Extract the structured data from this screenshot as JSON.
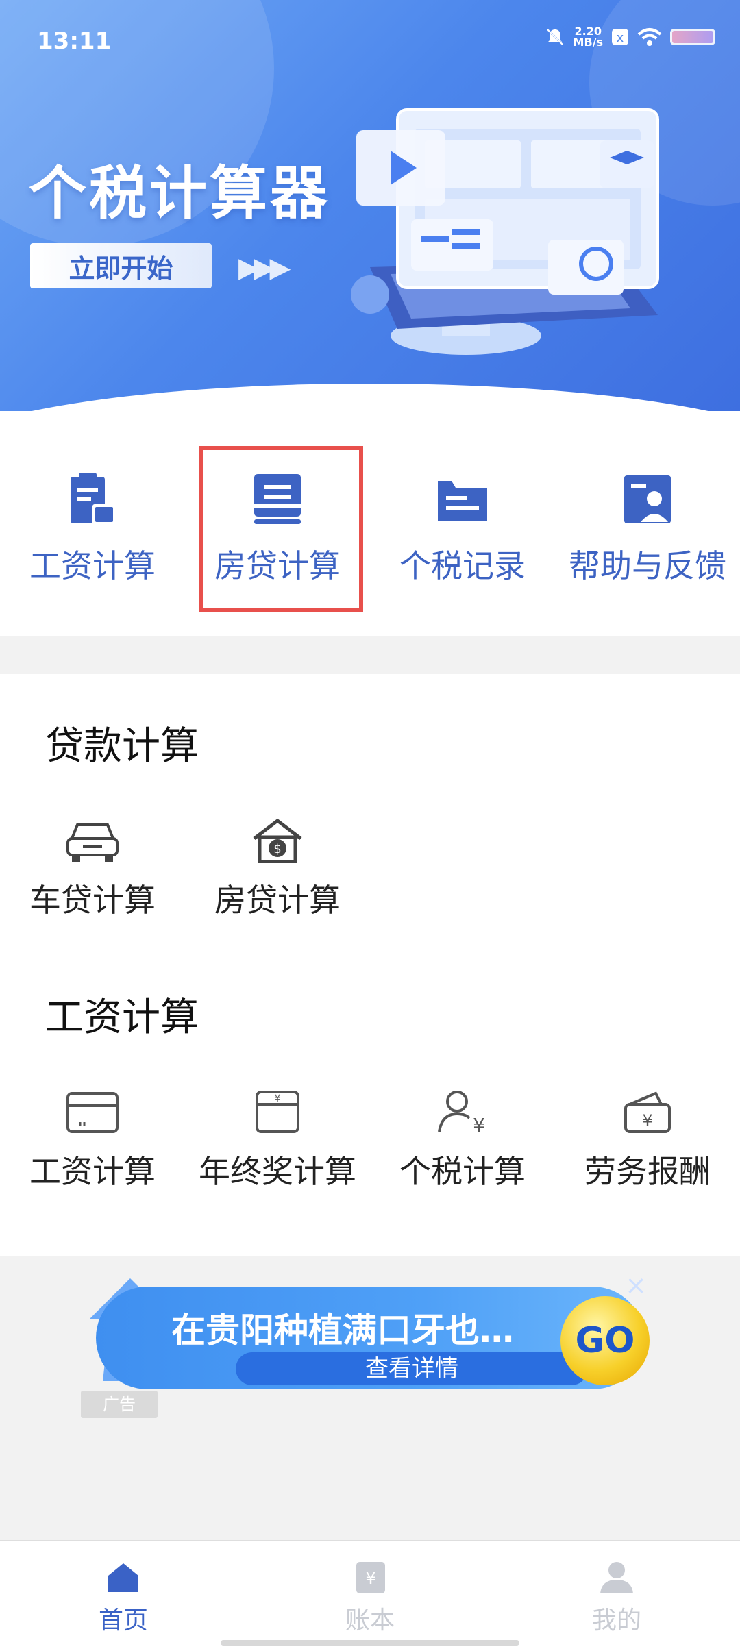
{
  "status_bar": {
    "time": "13:11",
    "net_speed_value": "2.20",
    "net_speed_unit": "MB/s"
  },
  "hero": {
    "title": "个税计算器",
    "start_button": "立即开始",
    "arrows": "▶▶▶"
  },
  "quick_grid": [
    {
      "label": "工资计算",
      "icon": "clipboard-icon"
    },
    {
      "label": "房贷计算",
      "icon": "document-lines-icon"
    },
    {
      "label": "个税记录",
      "icon": "folder-icon"
    },
    {
      "label": "帮助与反馈",
      "icon": "person-card-icon"
    }
  ],
  "highlight_color": "#e8504c",
  "loan_section": {
    "title": "贷款计算",
    "items": [
      {
        "label": "车贷计算",
        "icon": "car-icon"
      },
      {
        "label": "房贷计算",
        "icon": "house-dollar-icon"
      }
    ]
  },
  "salary_section": {
    "title": "工资计算",
    "items": [
      {
        "label": "工资计算",
        "icon": "card-icon"
      },
      {
        "label": "年终奖计算",
        "icon": "yen-envelope-icon"
      },
      {
        "label": "个税计算",
        "icon": "person-yen-icon"
      },
      {
        "label": "劳务报酬",
        "icon": "wallet-icon"
      }
    ]
  },
  "ad": {
    "text": "在贵阳种植满口牙也…",
    "sub_button": "查看详情",
    "go": "GO",
    "tag": "广告",
    "close": "×"
  },
  "bottom_nav": [
    {
      "label": "首页",
      "icon": "home-icon",
      "active": true
    },
    {
      "label": "账本",
      "icon": "ledger-icon",
      "active": false
    },
    {
      "label": "我的",
      "icon": "user-icon",
      "active": false
    }
  ],
  "colors": {
    "accent": "#3d63c3",
    "nav_active": "#3a62c6",
    "nav_inactive": "#c9ccd3"
  }
}
